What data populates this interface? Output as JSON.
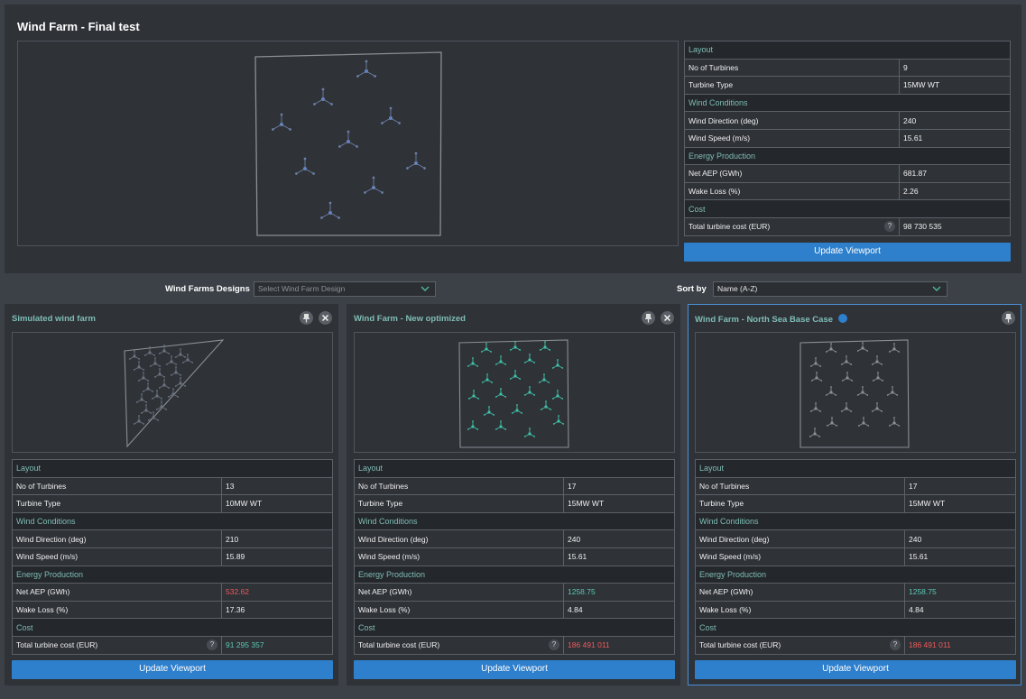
{
  "main": {
    "title": "Wind Farm - Final test",
    "sections": {
      "layout": "Layout",
      "wind": "Wind Conditions",
      "energy": "Energy Production",
      "cost": "Cost"
    },
    "labels": {
      "turbines": "No of Turbines",
      "type": "Turbine Type",
      "direction": "Wind Direction (deg)",
      "speed": "Wind Speed (m/s)",
      "aep": "Net AEP (GWh)",
      "wake": "Wake Loss (%)",
      "cost": "Total turbine cost (EUR)"
    },
    "help": "?",
    "values": {
      "turbines": "9",
      "type": "15MW WT",
      "direction": "240",
      "speed": "15.61",
      "aep": "681.87",
      "wake": "2.26",
      "cost": "98 730 535"
    },
    "update_button": "Update Viewport"
  },
  "filters": {
    "designs_label": "Wind Farms Designs",
    "designs_placeholder": "Select Wind Farm Design",
    "sort_label": "Sort by",
    "sort_value": "Name (A-Z)"
  },
  "cards": [
    {
      "title": "Simulated wind farm",
      "values": {
        "turbines": "13",
        "type": "10MW WT",
        "direction": "210",
        "speed": "15.89",
        "aep": "532.62",
        "wake": "17.36",
        "cost": "91 295 357"
      },
      "update_button": "Update Viewport"
    },
    {
      "title": "Wind Farm - New optimized",
      "values": {
        "turbines": "17",
        "type": "15MW WT",
        "direction": "240",
        "speed": "15.61",
        "aep": "1258.75",
        "wake": "4.84",
        "cost": "186 491 011"
      },
      "update_button": "Update Viewport"
    },
    {
      "title": "Wind Farm - North Sea Base Case",
      "values": {
        "turbines": "17",
        "type": "15MW WT",
        "direction": "240",
        "speed": "15.61",
        "aep": "1258.75",
        "wake": "4.84",
        "cost": "186 491 011"
      },
      "update_button": "Update Viewport"
    }
  ],
  "icons": {
    "pin": "pin-icon",
    "close": "close-icon",
    "chevron": "chevron-down-icon"
  },
  "colors": {
    "accent": "#2e7fcc",
    "section_text": "#7fbdb6",
    "good": "#5cc7b4",
    "bad": "#f05a5a"
  }
}
